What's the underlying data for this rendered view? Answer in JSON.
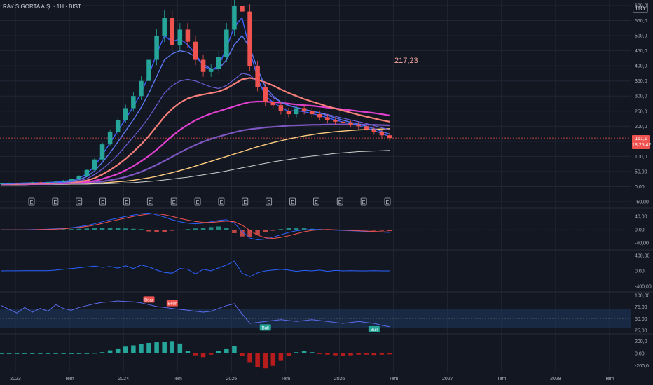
{
  "header": {
    "title": "RAY SİGORTA A.Ş. · 1H · BIST",
    "currency": "TRY"
  },
  "callout": {
    "label": "217,23"
  },
  "price_tag": {
    "price": "161,1",
    "countdown": "18:25:42"
  },
  "colors": {
    "background": "#131722",
    "grid": "#232734",
    "up": "#26a69a",
    "down": "#ef5350",
    "ma1": "#3f5ffb",
    "ma2": "#5b77f0",
    "ma3": "#6c5fd8",
    "ma4": "#f77f7a",
    "ma5": "#e040d0",
    "ma6": "#7e57c2",
    "ma7": "#ffcc80",
    "ma8": "#cfcfcf",
    "macd": "#2962ff",
    "signal": "#ef5350",
    "rsi": "#5b6cf0"
  },
  "chart_data": [
    {
      "type": "candlestick",
      "pane": "price",
      "y_ticks": [
        "600,0",
        "550,0",
        "500,0",
        "450,0",
        "400,0",
        "350,0",
        "300,0",
        "250,0",
        "200,0",
        "150,0",
        "100,0",
        "50,00",
        "0,00",
        "-50,00"
      ],
      "ylim": [
        -50,
        600
      ],
      "x_ticks": [
        "2023",
        "Tem",
        "2024",
        "Tem",
        "2025",
        "Tem",
        "2026",
        "Tem",
        "2027",
        "Tem",
        "2028",
        "Tem"
      ],
      "events": [
        "E",
        "E",
        "E",
        "E",
        "E",
        "E",
        "E",
        "E",
        "E",
        "E",
        "E",
        "E",
        "E",
        "E",
        "E",
        "E"
      ],
      "x": [
        0,
        0.02,
        0.04,
        0.06,
        0.08,
        0.1,
        0.12,
        0.14,
        0.16,
        0.18,
        0.2,
        0.22,
        0.24,
        0.26,
        0.28,
        0.3,
        0.32,
        0.34,
        0.36,
        0.38,
        0.4,
        0.42,
        0.44,
        0.46,
        0.48,
        0.5,
        0.52,
        0.54,
        0.56,
        0.58,
        0.6,
        0.62,
        0.64,
        0.66,
        0.68,
        0.7,
        0.72,
        0.74,
        0.76,
        0.78,
        0.8,
        0.82,
        0.84,
        0.86,
        0.88,
        0.9,
        0.92,
        0.94,
        0.96,
        0.98,
        1
      ],
      "close": [
        10,
        12,
        11,
        13,
        14,
        12,
        15,
        16,
        20,
        25,
        35,
        55,
        90,
        140,
        180,
        220,
        260,
        300,
        350,
        420,
        500,
        560,
        470,
        520,
        480,
        420,
        380,
        390,
        430,
        520,
        600,
        580,
        400,
        330,
        280,
        270,
        250,
        240,
        260,
        250,
        240,
        230,
        220,
        215,
        210,
        205,
        200,
        190,
        180,
        170,
        161
      ],
      "moving_averages": [
        {
          "name": "MA1",
          "values": [
            10,
            11,
            11,
            12,
            13,
            13,
            14,
            15,
            17,
            21,
            28,
            42,
            68,
            105,
            145,
            185,
            225,
            265,
            310,
            370,
            440,
            500,
            480,
            490,
            470,
            440,
            400,
            385,
            400,
            460,
            530,
            560,
            450,
            360,
            300,
            280,
            262,
            250,
            252,
            248,
            242,
            236,
            228,
            221,
            214,
            208,
            202,
            195,
            186,
            176,
            166
          ]
        },
        {
          "name": "MA2",
          "values": [
            9,
            10,
            10,
            11,
            12,
            12,
            13,
            14,
            15,
            18,
            23,
            33,
            52,
            80,
            112,
            148,
            185,
            222,
            262,
            310,
            365,
            420,
            440,
            450,
            445,
            430,
            405,
            390,
            390,
            420,
            470,
            500,
            460,
            390,
            330,
            300,
            280,
            268,
            262,
            256,
            250,
            244,
            236,
            228,
            220,
            213,
            207,
            200,
            192,
            183,
            174
          ]
        },
        {
          "name": "MA3",
          "values": [
            9,
            9,
            10,
            10,
            11,
            11,
            12,
            13,
            14,
            16,
            19,
            26,
            40,
            58,
            80,
            105,
            135,
            165,
            195,
            230,
            270,
            310,
            335,
            350,
            355,
            350,
            340,
            330,
            325,
            335,
            355,
            375,
            370,
            345,
            315,
            295,
            280,
            270,
            262,
            256,
            250,
            245,
            239,
            233,
            227,
            221,
            215,
            209,
            202,
            195,
            188
          ]
        },
        {
          "name": "MA4",
          "values": [
            9,
            9,
            9,
            10,
            10,
            11,
            11,
            12,
            13,
            14,
            16,
            20,
            28,
            40,
            55,
            72,
            92,
            115,
            140,
            168,
            200,
            232,
            258,
            278,
            292,
            300,
            305,
            310,
            315,
            325,
            340,
            355,
            360,
            355,
            345,
            335,
            322,
            310,
            300,
            290,
            282,
            274,
            266,
            259,
            252,
            245,
            238,
            232,
            226,
            220,
            215
          ]
        },
        {
          "name": "MA5",
          "values": [
            8,
            8,
            9,
            9,
            9,
            10,
            10,
            11,
            11,
            12,
            13,
            15,
            19,
            25,
            33,
            42,
            54,
            68,
            84,
            102,
            122,
            145,
            168,
            188,
            205,
            220,
            232,
            242,
            250,
            258,
            266,
            274,
            280,
            282,
            282,
            280,
            278,
            275,
            272,
            270,
            268,
            265,
            262,
            259,
            256,
            253,
            250,
            247,
            244,
            240,
            236
          ]
        },
        {
          "name": "MA6",
          "values": [
            8,
            8,
            8,
            8,
            9,
            9,
            9,
            10,
            10,
            11,
            11,
            12,
            14,
            17,
            21,
            26,
            32,
            40,
            49,
            60,
            72,
            85,
            99,
            113,
            126,
            138,
            149,
            158,
            166,
            173,
            180,
            186,
            190,
            193,
            196,
            198,
            200,
            202,
            203,
            204,
            205,
            205,
            206,
            206,
            206,
            206,
            206,
            205,
            205,
            204,
            203
          ]
        },
        {
          "name": "MA7",
          "values": [
            7,
            7,
            7,
            8,
            8,
            8,
            8,
            9,
            9,
            9,
            10,
            10,
            11,
            12,
            14,
            16,
            18,
            21,
            25,
            29,
            34,
            40,
            46,
            53,
            60,
            68,
            76,
            84,
            92,
            100,
            108,
            116,
            124,
            132,
            139,
            146,
            152,
            158,
            163,
            168,
            172,
            176,
            179,
            182,
            184,
            186,
            188,
            189,
            190,
            191,
            192
          ]
        },
        {
          "name": "MA8",
          "values": [
            6,
            6,
            6,
            6,
            7,
            7,
            7,
            7,
            7,
            8,
            8,
            8,
            9,
            9,
            10,
            11,
            12,
            13,
            15,
            17,
            19,
            22,
            25,
            28,
            31,
            35,
            39,
            43,
            47,
            52,
            57,
            62,
            67,
            72,
            77,
            82,
            86,
            90,
            94,
            98,
            101,
            104,
            107,
            110,
            112,
            114,
            116,
            117,
            118,
            119,
            120
          ]
        }
      ]
    },
    {
      "type": "bar",
      "pane": "macd",
      "y_ticks": [
        "40,00",
        "0,00",
        "-40,00"
      ],
      "ylim": [
        -50,
        55
      ],
      "values": [
        0,
        0,
        0,
        0,
        0.5,
        0.5,
        1,
        1,
        1.5,
        2,
        3,
        4,
        5,
        6,
        6,
        5,
        4,
        3,
        2,
        -5,
        -8,
        -6,
        -3,
        -1,
        2,
        4,
        6,
        8,
        10,
        6,
        -10,
        -20,
        -22,
        -15,
        -8,
        -3,
        2,
        5,
        6,
        5,
        3,
        2,
        1,
        0,
        -1,
        -1,
        -2,
        -2,
        -3,
        -3,
        -4
      ],
      "macd_line": [
        0,
        0,
        0,
        0,
        1,
        1,
        2,
        3,
        4,
        6,
        9,
        13,
        18,
        24,
        30,
        35,
        40,
        44,
        48,
        50,
        45,
        38,
        30,
        24,
        20,
        18,
        20,
        24,
        28,
        30,
        20,
        -5,
        -25,
        -30,
        -28,
        -22,
        -15,
        -8,
        -3,
        0,
        1,
        1,
        0,
        -1,
        -2,
        -3,
        -4,
        -5,
        -6,
        -7,
        -8
      ],
      "signal_line": [
        0,
        0,
        0,
        0,
        0,
        1,
        1,
        2,
        3,
        5,
        7,
        10,
        14,
        19,
        25,
        30,
        35,
        40,
        44,
        47,
        48,
        45,
        40,
        34,
        29,
        25,
        22,
        22,
        24,
        26,
        24,
        14,
        -2,
        -16,
        -24,
        -26,
        -23,
        -18,
        -12,
        -6,
        -2,
        0,
        1,
        0,
        -1,
        -2,
        -3,
        -4,
        -5,
        -6,
        -7
      ]
    },
    {
      "type": "line",
      "pane": "oscillator",
      "y_ticks": [
        "400,00",
        "0,00",
        "-400,00"
      ],
      "ylim": [
        -450,
        450
      ],
      "values": [
        0,
        2,
        1,
        3,
        5,
        4,
        6,
        20,
        40,
        60,
        80,
        100,
        120,
        90,
        110,
        70,
        130,
        60,
        150,
        100,
        20,
        -40,
        -60,
        60,
        40,
        -80,
        40,
        0,
        80,
        150,
        250,
        -60,
        -150,
        -50,
        0,
        20,
        40,
        20,
        -10,
        10,
        0,
        20,
        -10,
        10,
        0,
        5,
        0,
        0,
        5,
        0,
        0
      ]
    },
    {
      "type": "line",
      "pane": "rsi",
      "y_ticks": [
        "100,00",
        "75,00",
        "50,00",
        "25,00"
      ],
      "ylim": [
        25,
        100
      ],
      "values": [
        78,
        70,
        62,
        74,
        64,
        72,
        66,
        80,
        72,
        68,
        74,
        78,
        82,
        85,
        86,
        88,
        87,
        86,
        84,
        80,
        76,
        74,
        72,
        70,
        68,
        66,
        64,
        66,
        72,
        78,
        82,
        60,
        40,
        42,
        44,
        46,
        48,
        46,
        44,
        46,
        48,
        46,
        44,
        42,
        40,
        42,
        44,
        42,
        40,
        36,
        33
      ],
      "labels": [
        {
          "text": "Bear",
          "kind": "bear"
        },
        {
          "text": "Bear",
          "kind": "bear"
        },
        {
          "text": "Bull",
          "kind": "bull"
        },
        {
          "text": "Bull",
          "kind": "bull"
        }
      ]
    },
    {
      "type": "bar",
      "pane": "momentum",
      "y_ticks": [
        "200,0",
        "0,00",
        "-200,0"
      ],
      "ylim": [
        -260,
        260
      ],
      "values": [
        0,
        0,
        0,
        0,
        0,
        0,
        0,
        0,
        0,
        0,
        0,
        0,
        5,
        20,
        50,
        80,
        110,
        130,
        150,
        170,
        180,
        190,
        200,
        160,
        40,
        -30,
        -60,
        -20,
        40,
        80,
        120,
        -40,
        -140,
        -220,
        -240,
        -200,
        -120,
        -40,
        20,
        40,
        20,
        -10,
        -20,
        -30,
        -40,
        -30,
        -20,
        -20,
        -25,
        -20,
        -15
      ]
    }
  ]
}
